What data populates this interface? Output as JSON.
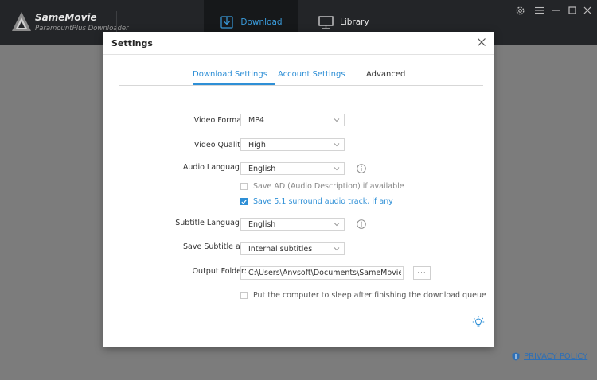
{
  "app": {
    "name": "SameMovie",
    "subtitle": "ParamountPlus Downloader"
  },
  "nav": {
    "download_label": "Download",
    "library_label": "Library",
    "active": "Download"
  },
  "window_controls": [
    "settings-icon",
    "menu-icon",
    "minimize-icon",
    "maximize-icon",
    "close-icon"
  ],
  "privacy_policy": "PRIVACY POLICY",
  "dialog": {
    "title": "Settings",
    "tabs": [
      {
        "label": "Download Settings",
        "active": true
      },
      {
        "label": "Account Settings",
        "active": false
      },
      {
        "label": "Advanced",
        "active": false
      }
    ],
    "video_format": {
      "label": "Video Format:",
      "value": "MP4"
    },
    "video_quality": {
      "label": "Video Quality:",
      "value": "High"
    },
    "audio_language": {
      "label": "Audio Language:",
      "value": "English"
    },
    "save_ad": {
      "label": "Save AD (Audio Description) if available",
      "checked": false
    },
    "save_51": {
      "label": "Save 5.1 surround audio track, if any",
      "checked": true
    },
    "subtitle_language": {
      "label": "Subtitle Language:",
      "value": "English"
    },
    "save_subtitle_as": {
      "label": "Save Subtitle as:",
      "value": "Internal subtitles"
    },
    "output_folder": {
      "label": "Output Folder:",
      "value": "C:\\Users\\Anvsoft\\Documents\\SameMovie Pa",
      "browse_label": "···"
    },
    "sleep": {
      "label": "Put the computer to sleep after finishing the download queue",
      "checked": false
    }
  },
  "colors": {
    "accent": "#2e8fd6",
    "topbar": "#232528",
    "overlay": "#7c7c7c",
    "link": "#2d6fb6"
  }
}
